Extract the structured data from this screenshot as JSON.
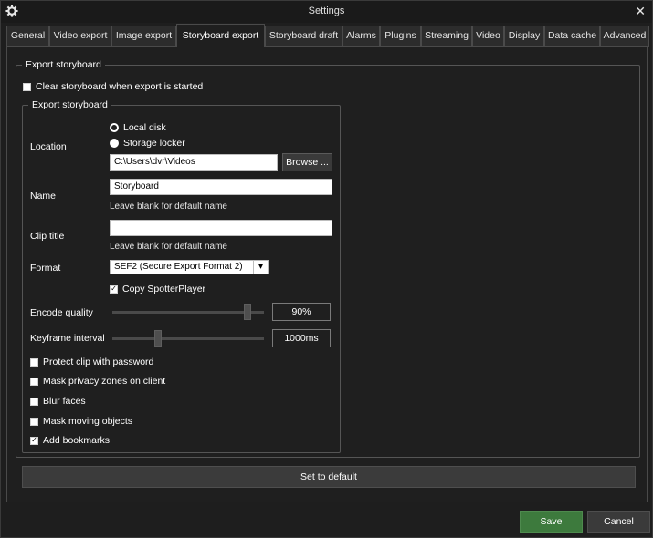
{
  "window": {
    "title": "Settings",
    "close_glyph": "✕"
  },
  "tabs": [
    {
      "label": "General"
    },
    {
      "label": "Video export"
    },
    {
      "label": "Image export"
    },
    {
      "label": "Storyboard export"
    },
    {
      "label": "Storyboard draft"
    },
    {
      "label": "Alarms"
    },
    {
      "label": "Plugins"
    },
    {
      "label": "Streaming"
    },
    {
      "label": "Video"
    },
    {
      "label": "Display"
    },
    {
      "label": "Data cache"
    },
    {
      "label": "Advanced"
    }
  ],
  "active_tab": "Storyboard export",
  "outer_group": {
    "title": "Export storyboard",
    "clear_checkbox": {
      "label": "Clear storyboard when export is started",
      "checked": false
    }
  },
  "inner_group": {
    "title": "Export storyboard",
    "location": {
      "label": "Location",
      "options": [
        {
          "label": "Local disk",
          "selected": true
        },
        {
          "label": "Storage locker",
          "selected": false
        }
      ],
      "path": "C:\\Users\\dvr\\Videos",
      "browse_label": "Browse ..."
    },
    "name": {
      "label": "Name",
      "value": "Storyboard",
      "hint": "Leave blank for default name"
    },
    "clip_title": {
      "label": "Clip title",
      "value": "",
      "hint": "Leave blank for default name"
    },
    "format": {
      "label": "Format",
      "value": "SEF2 (Secure Export Format 2)",
      "arrow_glyph": "▾"
    },
    "copy_player": {
      "label": "Copy SpotterPlayer",
      "checked": true
    },
    "encode_quality": {
      "label": "Encode quality",
      "value": "90%",
      "level": 0.9
    },
    "keyframe_interval": {
      "label": "Keyframe interval",
      "value": "1000ms",
      "level": 0.3
    },
    "options": [
      {
        "label": "Protect clip with password",
        "checked": false
      },
      {
        "label": "Mask privacy zones on client",
        "checked": false
      },
      {
        "label": "Blur faces",
        "checked": false
      },
      {
        "label": "Mask moving objects",
        "checked": false
      },
      {
        "label": "Add bookmarks",
        "checked": true
      }
    ]
  },
  "set_default_label": "Set to default",
  "footer": {
    "save_label": "Save",
    "cancel_label": "Cancel"
  },
  "colors": {
    "accent_green": "#3d7a3d",
    "background": "#1e1e1e"
  },
  "check_glyph": "✓"
}
